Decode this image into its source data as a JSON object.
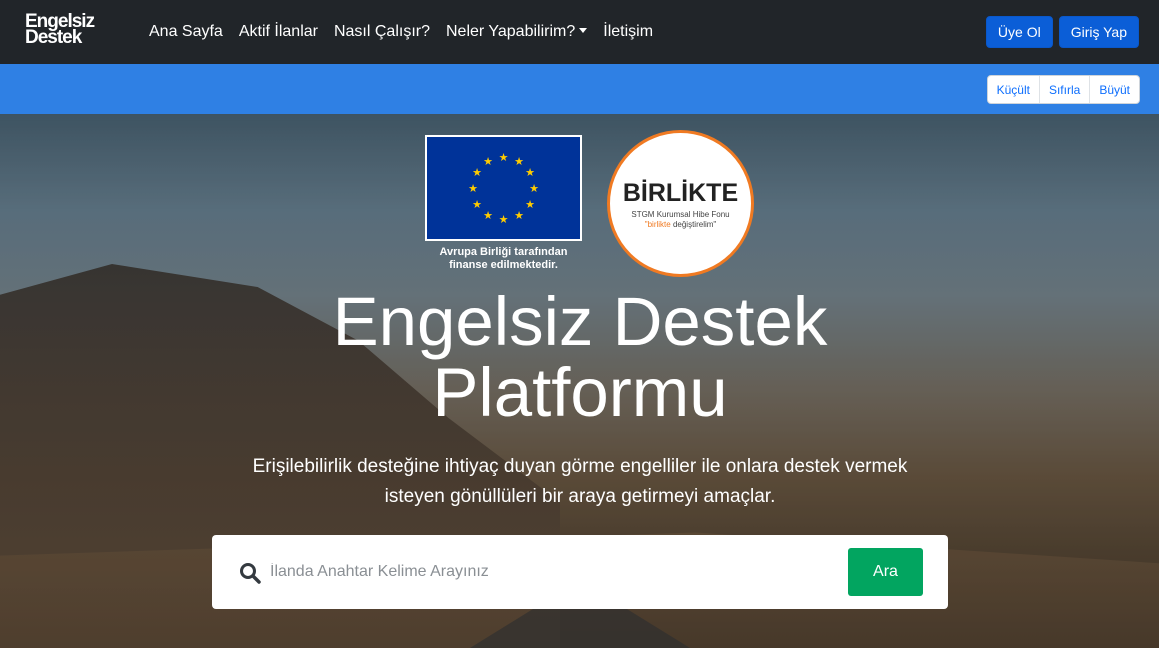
{
  "brand": {
    "line1": "Engelsiz",
    "line2": "Destek"
  },
  "nav": {
    "items": [
      {
        "label": "Ana Sayfa"
      },
      {
        "label": "Aktif İlanlar"
      },
      {
        "label": "Nasıl Çalışır?"
      },
      {
        "label": "Neler Yapabilirim?"
      },
      {
        "label": "İletişim"
      }
    ],
    "signup_label": "Üye Ol",
    "login_label": "Giriş Yap"
  },
  "accessibility": {
    "decrease_label": "Küçült",
    "reset_label": "Sıfırla",
    "increase_label": "Büyüt"
  },
  "logos": {
    "eu_caption_line1": "Avrupa Birliği tarafından",
    "eu_caption_line2": "finanse edilmektedir.",
    "birlikte_title": "BİRLİKTE",
    "birlikte_sub": "STGM Kurumsal Hibe Fonu",
    "birlikte_tag_accent": "\"birlikte",
    "birlikte_tag_rest": "değiştirelim\""
  },
  "hero": {
    "title_line1": "Engelsiz Destek",
    "title_line2": "Platformu",
    "subtitle_line1": "Erişilebilirlik desteğine ihtiyaç duyan görme engelliler ile onlara destek vermek",
    "subtitle_line2": "isteyen gönüllüleri bir araya getirmeyi amaçlar."
  },
  "search": {
    "placeholder": "İlanda Anahtar Kelime Arayınız",
    "value": "",
    "button_label": "Ara"
  },
  "colors": {
    "navbar": "#212529",
    "primary": "#0b5ed7",
    "a11y_bar": "#2f80e4",
    "search_button": "#02a560",
    "birlikte_accent": "#f07a22",
    "eu_blue": "#003399"
  }
}
